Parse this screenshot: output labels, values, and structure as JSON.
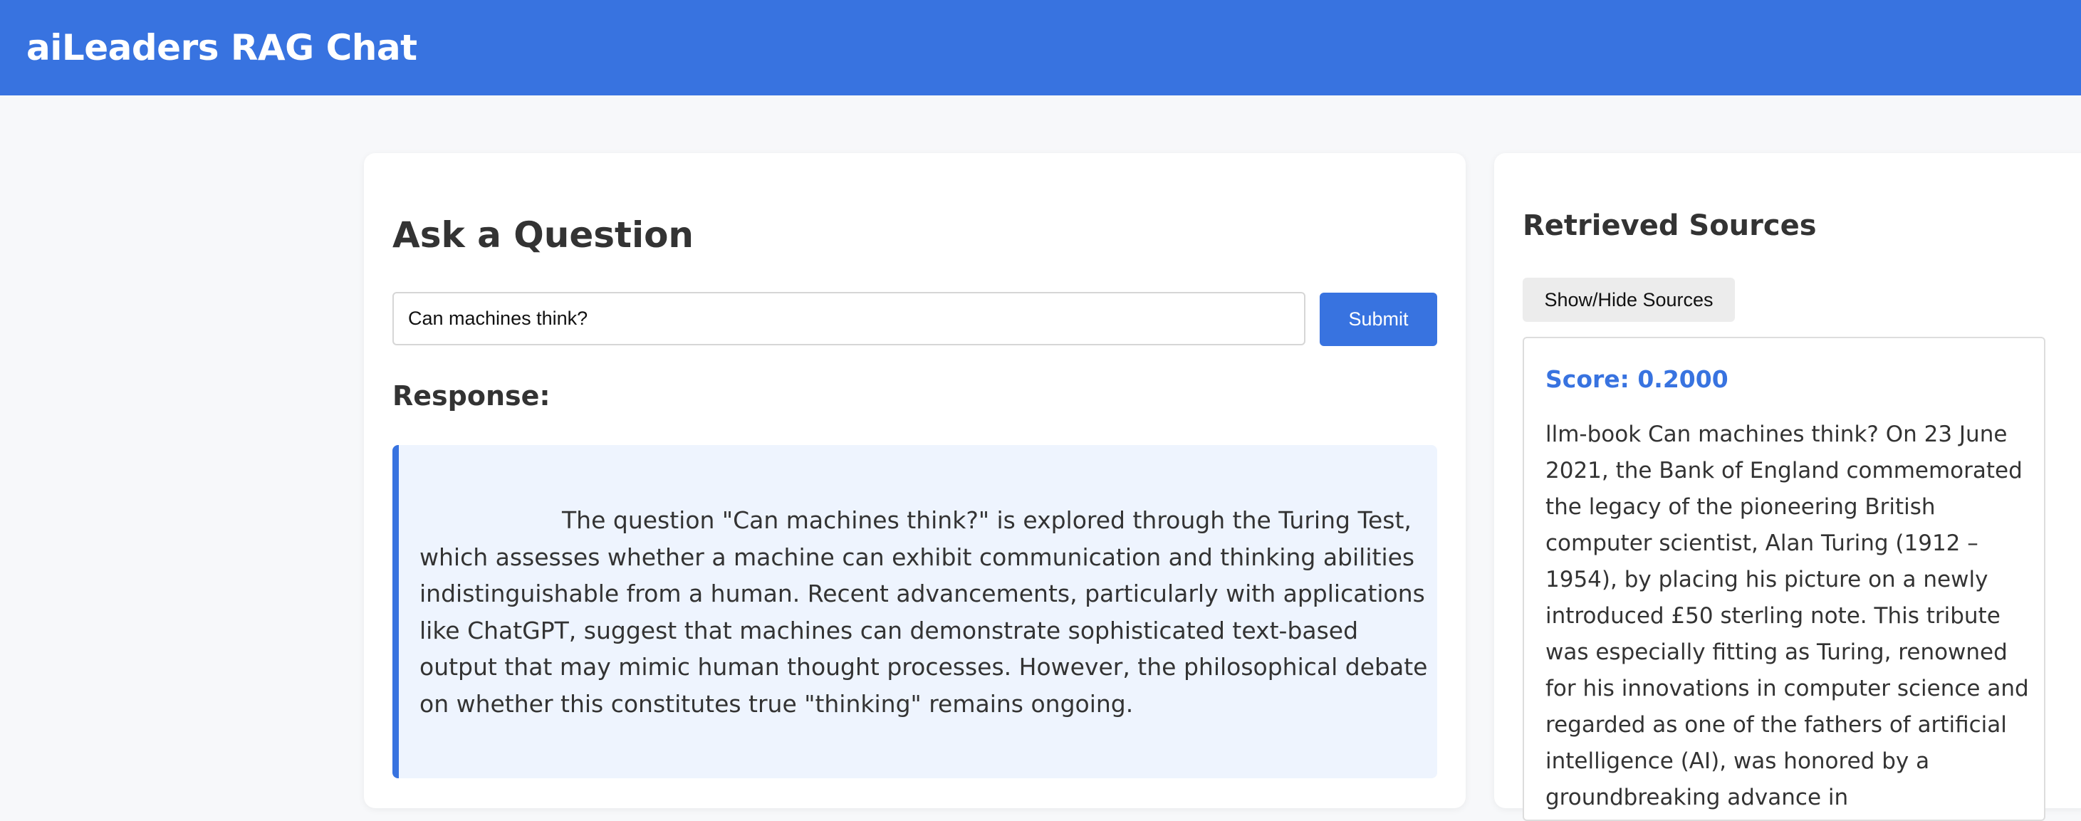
{
  "header": {
    "title": "aiLeaders RAG Chat"
  },
  "qa": {
    "title": "Ask a Question",
    "input_value": "Can machines think?",
    "submit_label": "Submit",
    "response_title": "Response:",
    "response_text": "The question \"Can machines think?\" is explored through the Turing Test, which assesses whether a machine can exhibit communication and thinking abilities indistinguishable from a human. Recent advancements, particularly with applications like ChatGPT, suggest that machines can demonstrate sophisticated text-based output that may mimic human thought processes. However, the philosophical debate on whether this constitutes true \"thinking\" remains ongoing."
  },
  "sources": {
    "title": "Retrieved Sources",
    "toggle_label": "Show/Hide Sources",
    "items": [
      {
        "score": "Score: 0.2000",
        "text": "llm-book Can machines think? On 23 June 2021, the Bank of England commemorated the legacy of the pioneering British computer scientist, Alan Turing (1912 – 1954), by placing his picture on a newly introduced £50 sterling note. This tribute was especially fitting as Turing, renowned for his innovations in computer science and regarded as one of the fathers of artificial intelligence (AI), was honored by a groundbreaking advance in"
      }
    ]
  },
  "colors": {
    "accent": "#3873e0",
    "page_bg": "#f7f8fa",
    "response_bg": "#eef4fe"
  }
}
